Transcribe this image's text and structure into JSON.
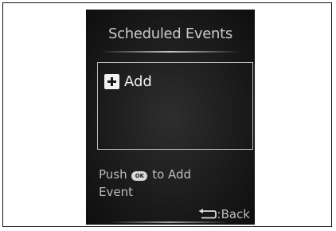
{
  "screen": {
    "title": "Scheduled Events",
    "add_label": "Add",
    "hint_prefix": "Push",
    "ok_icon_label": "OK",
    "hint_suffix": "to Add",
    "hint_line2": "Event",
    "back_label": ":Back"
  },
  "icons": {
    "add": "plus-icon",
    "ok": "ok-button-icon",
    "back": "return-arrow-icon"
  },
  "colors": {
    "screen_background": "#1c1c1c",
    "text": "#c9c9c9",
    "border": "#bdbdbd"
  }
}
